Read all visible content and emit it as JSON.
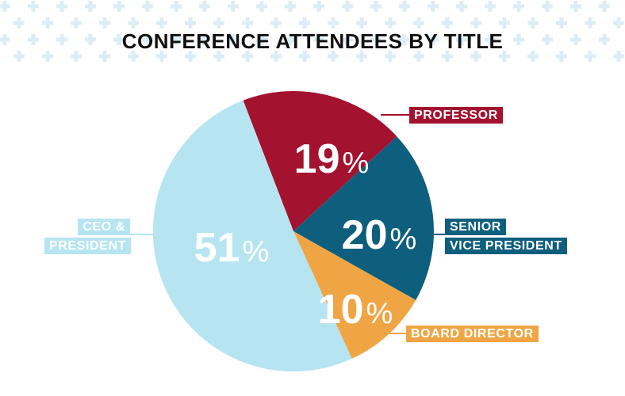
{
  "chart_data": {
    "type": "pie",
    "title": "CONFERENCE ATTENDEES BY TITLE",
    "slices": [
      {
        "label_lines": [
          "PROFESSOR"
        ],
        "value": 19,
        "display": "19",
        "color": "#a3122f"
      },
      {
        "label_lines": [
          "SENIOR",
          "VICE PRESIDENT"
        ],
        "value": 20,
        "display": "20",
        "color": "#0e5f7d"
      },
      {
        "label_lines": [
          "BOARD DIRECTOR"
        ],
        "value": 10,
        "display": "10",
        "color": "#f0a545"
      },
      {
        "label_lines": [
          "CEO &",
          "PRESIDENT"
        ],
        "value": 51,
        "display": "51",
        "color": "#b6e5f1"
      }
    ],
    "unit_symbol": "%"
  },
  "decor": {
    "pattern_color": "#dcedf6",
    "pattern_glyph": "plus-icon"
  }
}
